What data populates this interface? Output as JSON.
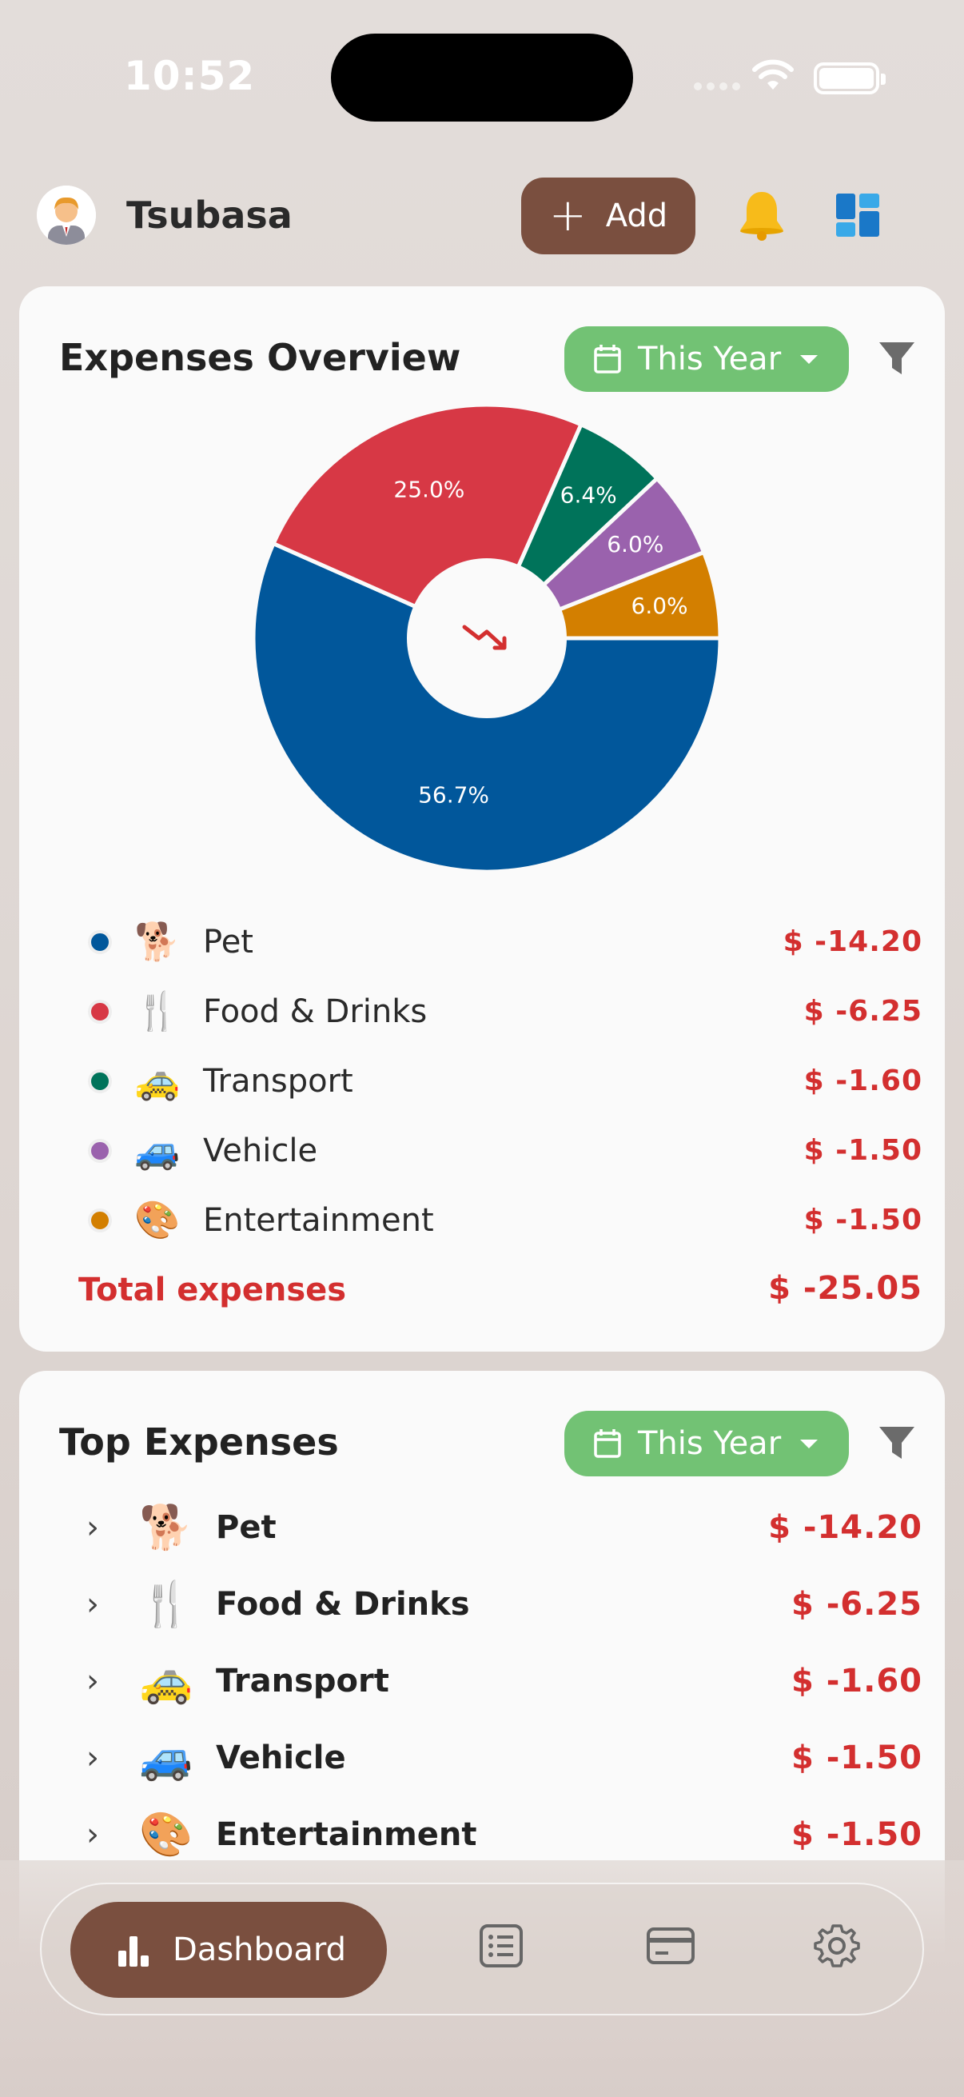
{
  "status": {
    "time": "10:52"
  },
  "header": {
    "user_name": "Tsubasa",
    "add_label": "Add"
  },
  "overview": {
    "title": "Expenses Overview",
    "period": "This Year",
    "items": [
      {
        "emoji": "🐕",
        "label": "Pet",
        "amount": "$ -14.20",
        "color": "#01579b"
      },
      {
        "emoji": "🍴",
        "label": "Food & Drinks",
        "amount": "$ -6.25",
        "color": "#d73845"
      },
      {
        "emoji": "🚕",
        "label": "Transport",
        "amount": "$ -1.60",
        "color": "#00735a"
      },
      {
        "emoji": "🚙",
        "label": "Vehicle",
        "amount": "$ -1.50",
        "color": "#9a62ad"
      },
      {
        "emoji": "🎨",
        "label": "Entertainment",
        "amount": "$ -1.50",
        "color": "#d37f00"
      }
    ],
    "total_label": "Total expenses",
    "total_amount": "$ -25.05"
  },
  "chart_data": {
    "type": "pie",
    "categories": [
      "Pet",
      "Food & Drinks",
      "Transport",
      "Vehicle",
      "Entertainment"
    ],
    "values": [
      56.7,
      25.0,
      6.4,
      6.0,
      6.0
    ],
    "labels": [
      "56.7%",
      "25.0%",
      "6.4%",
      "6.0%",
      "6.0%"
    ],
    "colors": [
      "#01579b",
      "#d73845",
      "#00735a",
      "#9a62ad",
      "#d37f00"
    ]
  },
  "top_expenses": {
    "title": "Top Expenses",
    "period": "This Year",
    "items": [
      {
        "emoji": "🐕",
        "label": "Pet",
        "amount": "$ -14.20"
      },
      {
        "emoji": "🍴",
        "label": "Food & Drinks",
        "amount": "$ -6.25"
      },
      {
        "emoji": "🚕",
        "label": "Transport",
        "amount": "$ -1.60"
      },
      {
        "emoji": "🚙",
        "label": "Vehicle",
        "amount": "$ -1.50"
      },
      {
        "emoji": "🎨",
        "label": "Entertainment",
        "amount": "$ -1.50"
      }
    ]
  },
  "nav": {
    "dashboard_label": "Dashboard"
  },
  "icons": {
    "bell": "bell-icon",
    "dashboard": "dashboard-icon",
    "filter": "filter-icon",
    "calendar": "calendar-icon",
    "list": "list-icon",
    "card": "credit-card-icon",
    "settings": "gear-icon",
    "trend": "trending-down-icon"
  }
}
